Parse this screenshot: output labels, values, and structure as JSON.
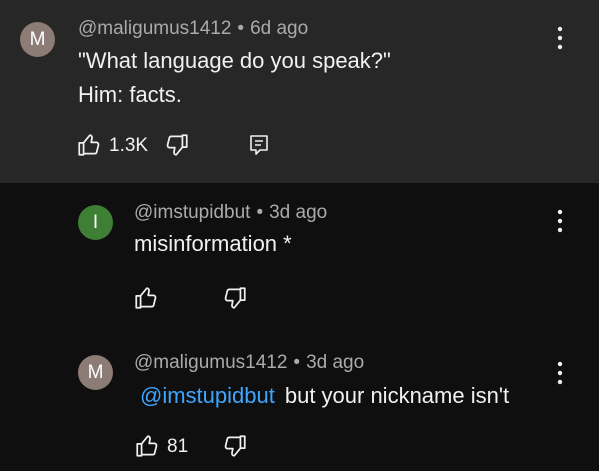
{
  "comment": {
    "avatar_letter": "M",
    "avatar_color": "#8d7b75",
    "handle": "@maligumus1412",
    "separator": "•",
    "time": "6d ago",
    "lines": [
      "\"What language do you speak?\"",
      "Him: facts."
    ],
    "like_count": "1.3K",
    "icons": [
      "like-icon",
      "dislike-icon",
      "reply-icon",
      "more-options-icon"
    ]
  },
  "reply1": {
    "avatar_letter": "I",
    "avatar_color": "#3f7f35",
    "handle": "@imstupidbut",
    "separator": "•",
    "time": "3d ago",
    "text": "misinformation *",
    "icons": [
      "like-icon",
      "dislike-icon",
      "more-options-icon"
    ]
  },
  "reply2": {
    "avatar_letter": "M",
    "avatar_color": "#8d7b75",
    "handle": "@maligumus1412",
    "separator": "•",
    "time": "3d ago",
    "mention": "@imstupidbut",
    "text": "but your nickname isn't",
    "like_count": "81",
    "icons": [
      "like-icon",
      "dislike-icon",
      "more-options-icon"
    ]
  },
  "colors": {
    "comment_bg": "#272727",
    "page_bg": "#0f0f0f",
    "mention": "#3ea6ff",
    "meta_text": "#aaaaaa"
  }
}
